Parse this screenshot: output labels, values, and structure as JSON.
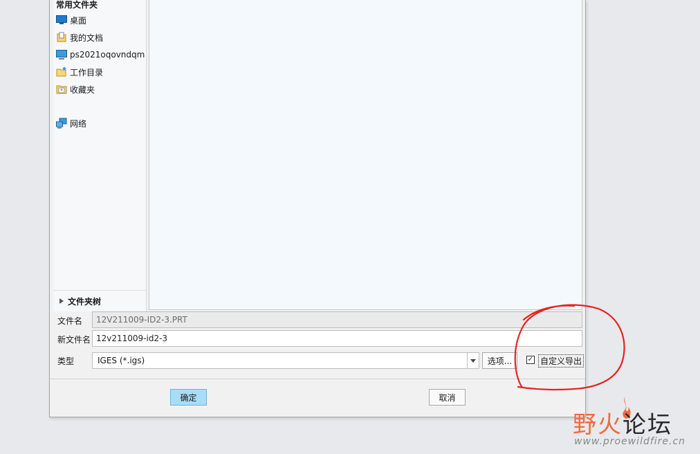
{
  "sidebar": {
    "heading": "常用文件夹",
    "items": [
      {
        "label": "桌面",
        "icon": "desktop-icon"
      },
      {
        "label": "我的文档",
        "icon": "documents-icon"
      },
      {
        "label": "ps2021oqovndqm",
        "icon": "computer-icon"
      },
      {
        "label": "工作目录",
        "icon": "working-directory-icon"
      },
      {
        "label": "收藏夹",
        "icon": "favorites-icon"
      },
      {
        "label": "网络",
        "icon": "network-icon"
      }
    ],
    "folder_tree": "文件夹树"
  },
  "form": {
    "filename_label": "文件名",
    "filename_value": "12V211009-ID2-3.PRT",
    "new_filename_label": "新文件名",
    "new_filename_value": "12v211009-id2-3",
    "type_label": "类型",
    "type_value": "IGES (*.igs)",
    "options_label": "选项...",
    "custom_export_label": "自定义导出",
    "custom_export_checked": true
  },
  "footer": {
    "ok_label": "确定",
    "cancel_label": "取消"
  },
  "annotation": {
    "color": "#e8231e"
  },
  "watermark": {
    "cn_part1": "野火",
    "cn_part2": "论坛",
    "url": "www.proewildfire.cn"
  },
  "colors": {
    "primary_button": "#a8ddf7",
    "list_background": "#f3f9fd"
  }
}
